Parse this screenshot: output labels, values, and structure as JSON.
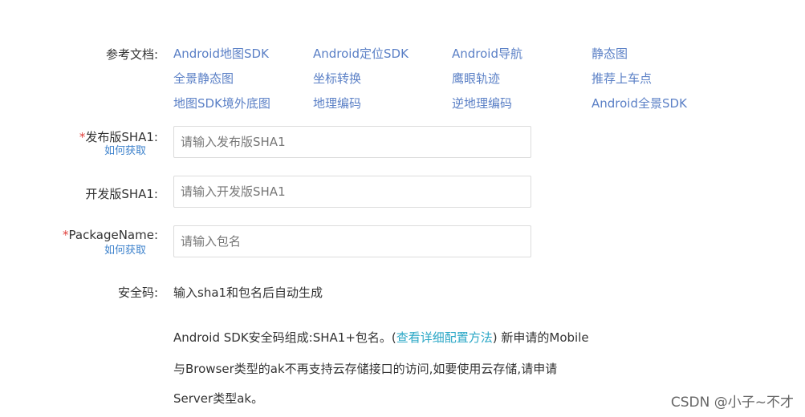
{
  "ref_docs": {
    "label": "参考文档:",
    "links": [
      "Android地图SDK",
      "Android定位SDK",
      "Android导航",
      "静态图",
      "全景静态图",
      "坐标转换",
      "鹰眼轨迹",
      "推荐上车点",
      "地图SDK境外底图",
      "地理编码",
      "逆地理编码",
      "Android全景SDK"
    ]
  },
  "release_sha1": {
    "required_mark": "*",
    "label": "发布版SHA1:",
    "help_link": "如何获取",
    "placeholder": "请输入发布版SHA1"
  },
  "dev_sha1": {
    "label": "开发版SHA1:",
    "placeholder": "请输入开发版SHA1"
  },
  "package_name": {
    "required_mark": "*",
    "label": "PackageName:",
    "help_link": "如何获取",
    "placeholder": "请输入包名"
  },
  "security_code": {
    "label": "安全码:",
    "value": "输入sha1和包名后自动生成"
  },
  "note": {
    "line1_before": "Android SDK安全码组成:SHA1+包名。(",
    "line1_link": "查看详细配置方法",
    "line1_after": ") 新申请的Mobile",
    "line2": "与Browser类型的ak不再支持云存储接口的访问,如要使用云存储,请申请",
    "line3": "Server类型ak。"
  },
  "watermark": "CSDN @小子~不才"
}
